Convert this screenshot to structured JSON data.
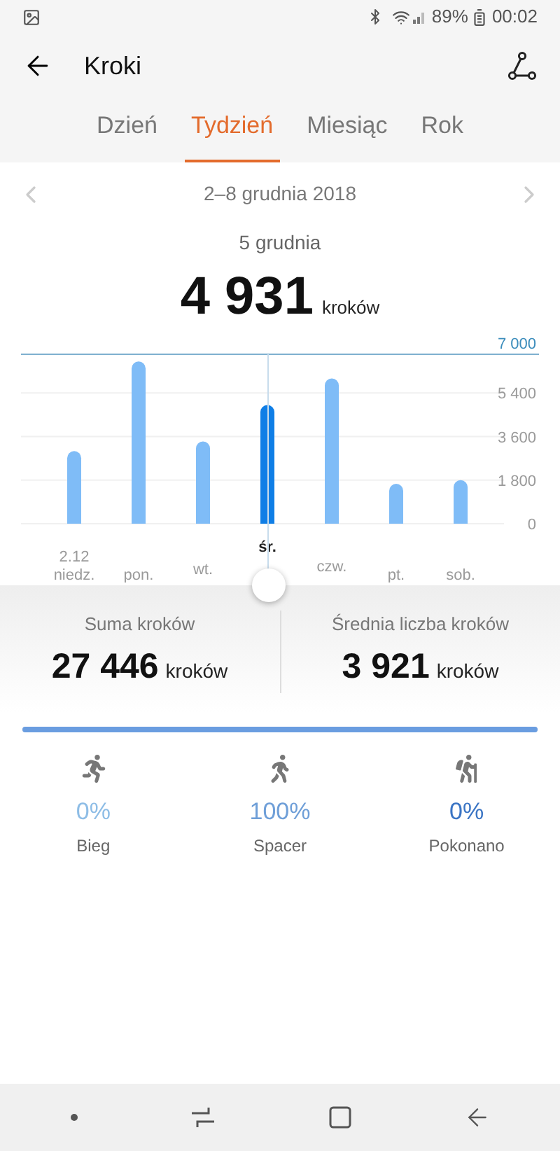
{
  "status_bar": {
    "battery": "89%",
    "time": "00:02"
  },
  "header": {
    "title": "Kroki"
  },
  "tabs": [
    {
      "label": "Dzień",
      "selected": false
    },
    {
      "label": "Tydzień",
      "selected": true
    },
    {
      "label": "Miesiąc",
      "selected": false
    },
    {
      "label": "Rok",
      "selected": false
    }
  ],
  "period": {
    "range": "2–8 grudnia 2018"
  },
  "selected_day": {
    "date": "5 grudnia",
    "steps": "4 931",
    "unit": "kroków"
  },
  "week_chart": {
    "first_date": "2.12",
    "days": [
      {
        "selected": false,
        "color": "#7fbcf7"
      },
      {
        "selected": false,
        "color": "#7fbcf7"
      },
      {
        "selected": false,
        "color": "#7fbcf7"
      },
      {
        "selected": true,
        "color": "#0f7ee6"
      },
      {
        "selected": false,
        "color": "#7fbcf7"
      },
      {
        "selected": false,
        "color": "#7fbcf7"
      },
      {
        "selected": false,
        "color": "#7fbcf7"
      }
    ],
    "chart_data": {
      "type": "bar",
      "categories": [
        "niedz.",
        "pon.",
        "wt.",
        "śr.",
        "czw.",
        "pt.",
        "sob."
      ],
      "grid": true,
      "values": [
        3000,
        6700,
        3400,
        4900,
        6000,
        1650,
        1800
      ],
      "ylim": [
        0,
        7000
      ],
      "yticks": [
        0,
        {
          "value": 1800,
          "label": "1 800"
        },
        {
          "value": 3600,
          "label": "3 600"
        },
        {
          "value": 5400,
          "label": "5 400"
        },
        {
          "value": 7000,
          "label": "7 000"
        }
      ]
    }
  },
  "summary": [
    {
      "label": "Suma kroków",
      "value": "27 446",
      "unit": "kroków"
    },
    {
      "label": "Średnia liczba kroków",
      "value": "3 921",
      "unit": "kroków"
    }
  ],
  "activity_bar": {
    "level": 1
  },
  "activities": [
    {
      "kind": "run",
      "percent": "0%",
      "label": "Bieg",
      "color": "#8ebde6"
    },
    {
      "kind": "walk",
      "percent": "100%",
      "label": "Spacer",
      "color": "#6f9fd8"
    },
    {
      "kind": "climb",
      "percent": "0%",
      "label": "Pokonano",
      "color": "#3a74c4"
    }
  ]
}
